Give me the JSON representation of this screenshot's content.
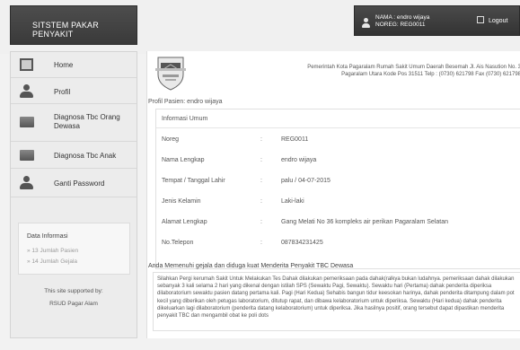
{
  "app": {
    "title": "SITSTEM PAKAR PENYAKIT"
  },
  "user": {
    "nama_line": "NAMA : endro wijaya",
    "noreg_line": "NOREG: REG0011"
  },
  "actions": {
    "logout_label": "Logout"
  },
  "sidebar": {
    "items": [
      {
        "label": "Home",
        "icon": "home-icon"
      },
      {
        "label": "Profil",
        "icon": "user-icon"
      },
      {
        "label": "Diagnosa Tbc Orang Dewasa",
        "icon": "folder-icon"
      },
      {
        "label": "Diagnosa Tbc Anak",
        "icon": "folder-icon"
      },
      {
        "label": "Ganti Password",
        "icon": "user-icon"
      }
    ],
    "info": {
      "title": "Data Informasi",
      "pasien": "» 13 Jumlah Pasien",
      "gejala": "» 14 Jumlah Gejala"
    },
    "support": {
      "line1": "This site supported by:",
      "line2": "RSUD Pagar Alam"
    }
  },
  "header": {
    "address_line1": "Pemerintah Kota Pagaralam Rumah Sakit Umum Daerah Besemah Jl. Ais Nasution No. 3",
    "address_line2": "Pagaralam Utara Kode Pos 31511 Telp : (0730) 621798 Fax (0730) 621798"
  },
  "profile": {
    "title": "Profil Pasien: endro wijaya",
    "section": "Informasi Umum",
    "separator": ":",
    "rows": [
      {
        "label": "Noreg",
        "value": "REG0011"
      },
      {
        "label": "Nama Lengkap",
        "value": "endro wijaya"
      },
      {
        "label": "Tempat / Tanggal Lahir",
        "value": "palu / 04-07-2015"
      },
      {
        "label": "Jenis Kelamin",
        "value": "Laki-laki"
      },
      {
        "label": "Alamat Lengkap",
        "value": "Gang Melati No 36 kompleks air perikan Pagaralam Selatan"
      },
      {
        "label": "No.Telepon",
        "value": "087834231425"
      }
    ]
  },
  "result": {
    "title": "Anda Memenuhi gejala dan diduga kuat Menderita Penyakit TBC Dewasa",
    "text": "Silahkan Pergi kerumah Sakit Untuk Melakukan Tes Dahak dilakukan pemeriksaan pada dahak(ralkya bukan ludahnya. pemeriksaan dahak dilakukan sebanyak 3 kali selama 2 hari yang dikenal dengan istilah SPS (Sewaktu Pagi, Sewaktu). Sewaktu hari (Pertama) dahak penderita diperiksa dilaboratorium sewaktu pasien datang pertama kali. Pagi (Hari Kedua) Sehabis bangun tidur keesokan harinya, dahak penderita ditampung dalam pot kecil yang diberikan oleh petugas laboratorium, ditutup rapat, dan dibawa kelaboratorium untuk diperiksa. Sewaktu (Hari kedua) dahak penderita dikeluarkan lagi dilaboratorium (penderita datang kelaboratorium) untuk diperiksa. Jika hasilnya positif, orang tersebut dapat dipastikan menderita penyakit TBC dan mengambil obat ke poli dots"
  }
}
